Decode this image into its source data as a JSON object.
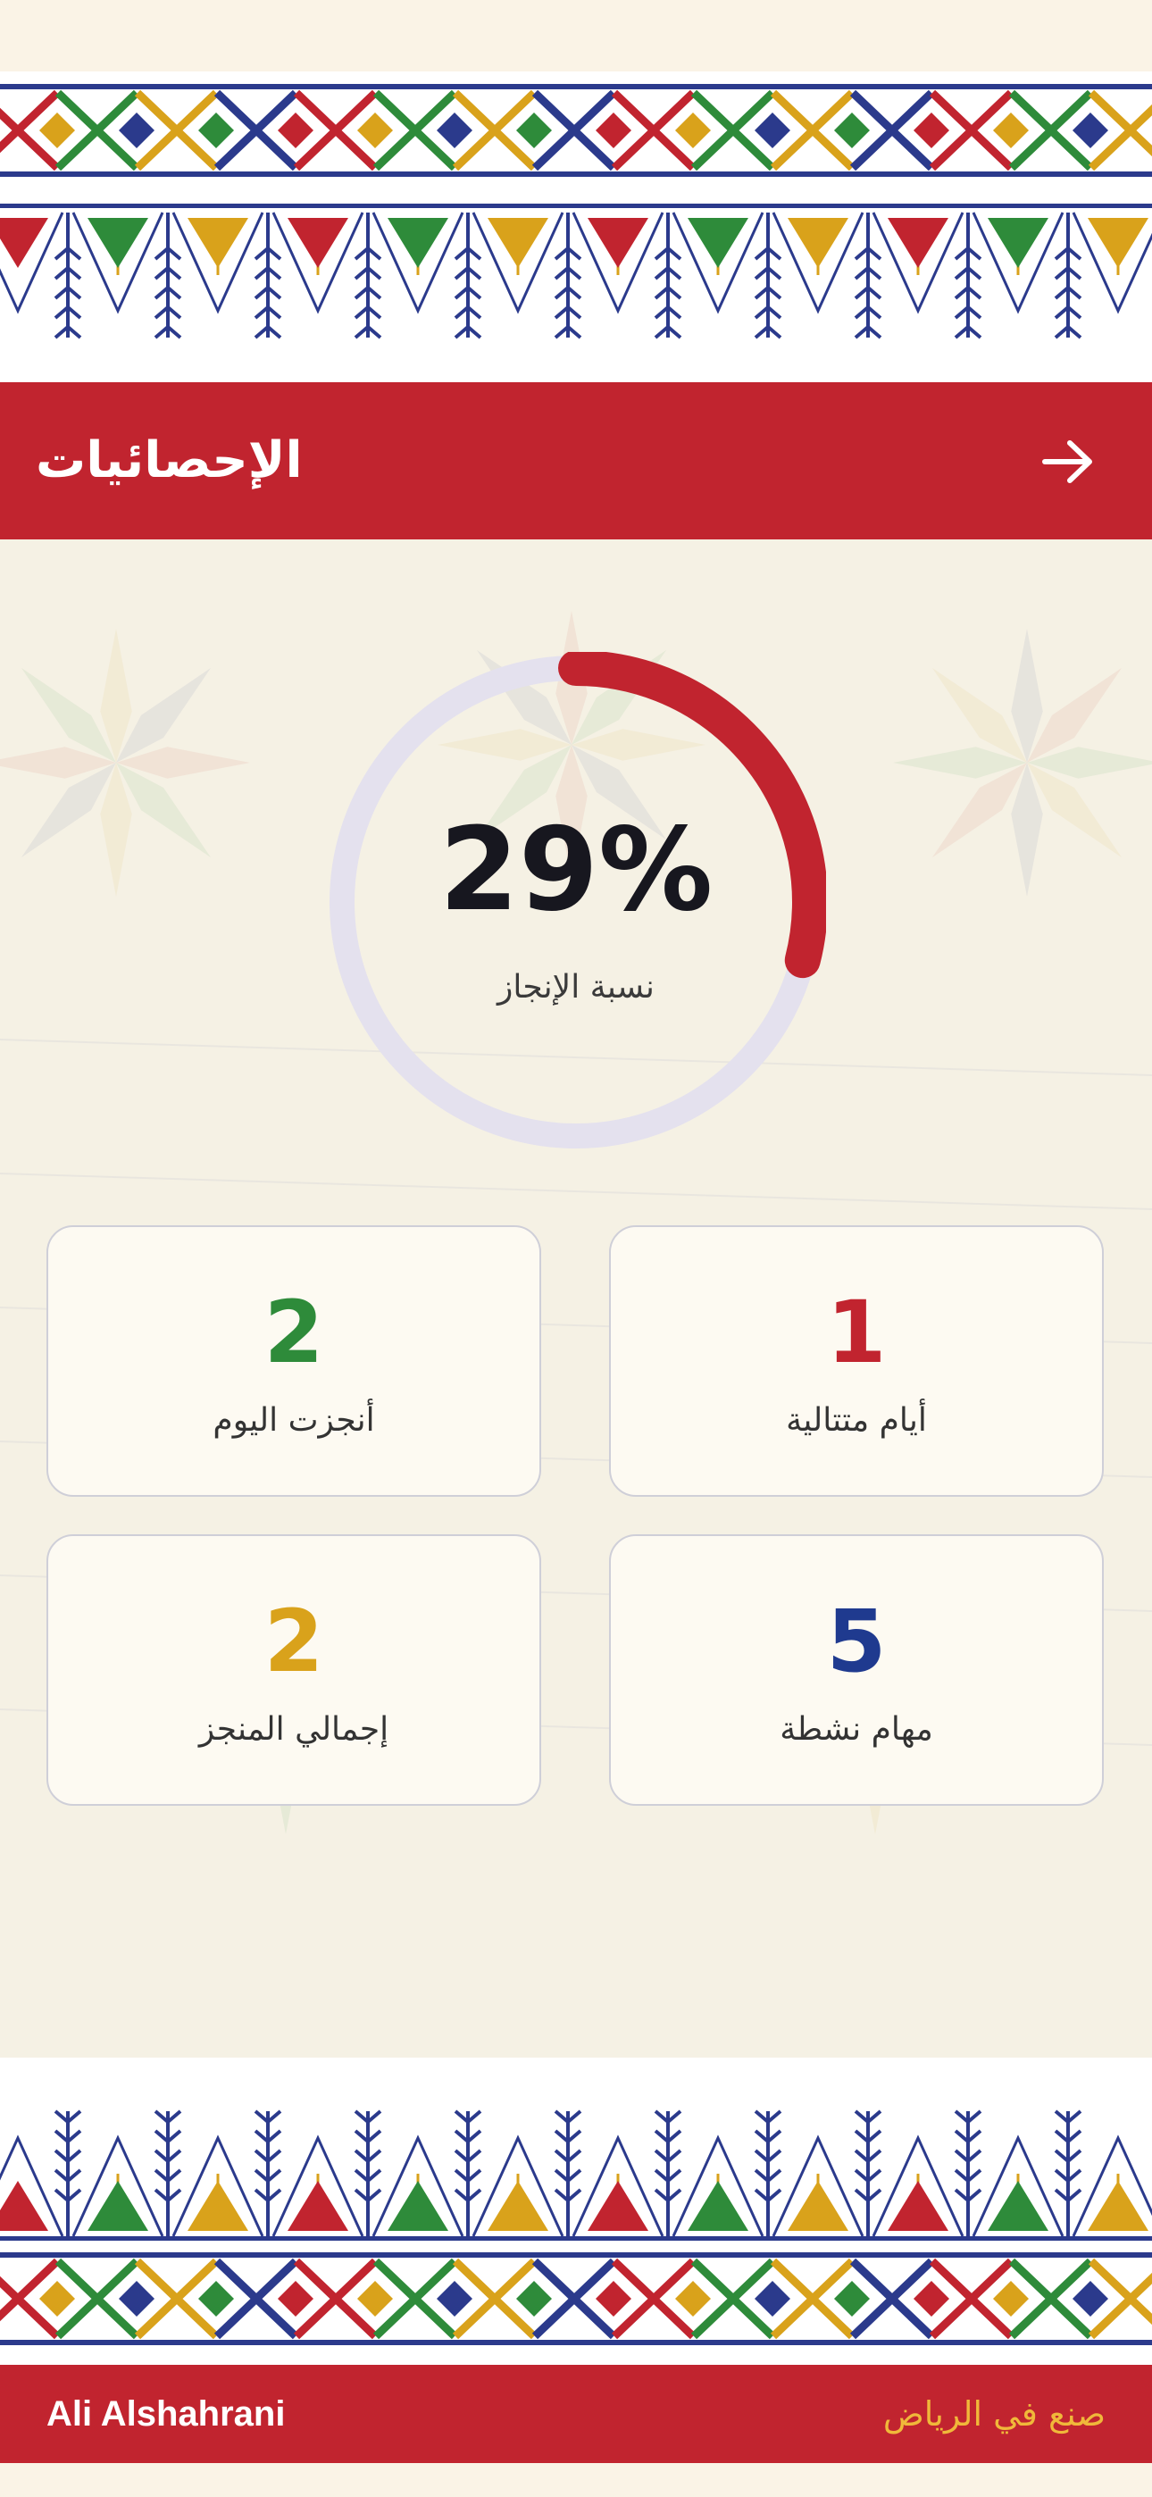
{
  "header": {
    "title": "الإحصائيات",
    "back_icon": "arrow-right-icon"
  },
  "progress": {
    "value_text": "29%",
    "fraction": 0.29,
    "label": "نسبة الإنجاز",
    "track_color": "#e4e1ee",
    "fill_color": "#c1242f"
  },
  "stats": [
    {
      "value": "1",
      "label": "أيام متتالية",
      "color": "#c1242f"
    },
    {
      "value": "2",
      "label": "أنجزت اليوم",
      "color": "#2e8b3a"
    },
    {
      "value": "5",
      "label": "مهام نشطة",
      "color": "#1f3a8f"
    },
    {
      "value": "2",
      "label": "إجمالي المنجز",
      "color": "#d9a21b"
    }
  ],
  "footer": {
    "author": "Ali Alshahrani",
    "made_in": "صنع في الرياض"
  },
  "colors": {
    "brand_red": "#c1242f",
    "navy": "#2b3a8c",
    "green": "#2e8b3a",
    "gold": "#d9a21b",
    "background": "#f5f1e4"
  }
}
